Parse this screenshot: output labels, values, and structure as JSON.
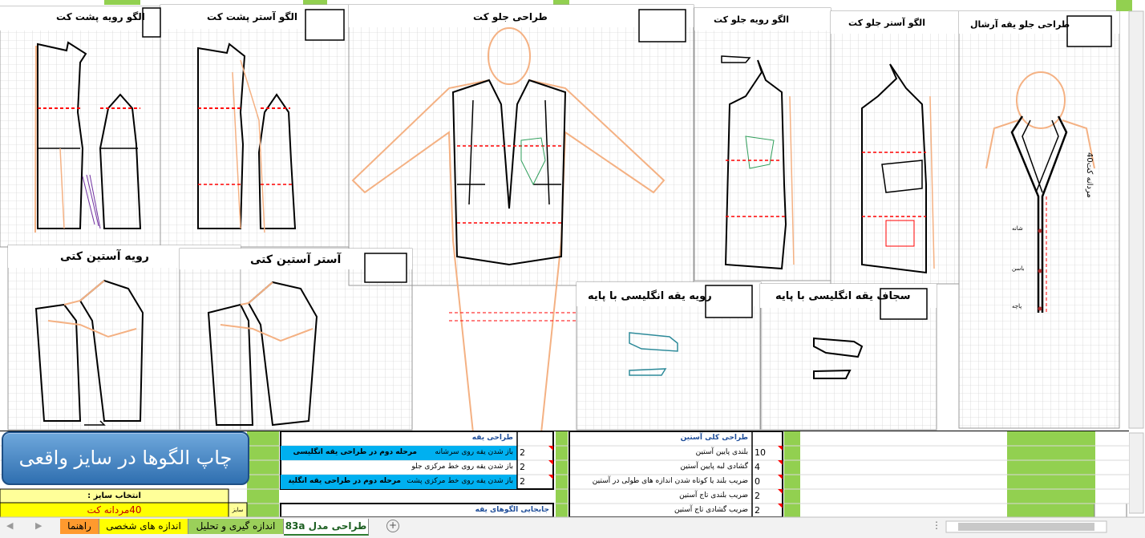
{
  "panels": {
    "back_outer_title": "الگو رویه پشت کت",
    "back_lining_title": "الگو آستر پشت کت",
    "front_design_title": "طراحی جلو کت",
    "front_outer_title": "الگو رویه جلو کت",
    "front_lining_title": "الگو آستر جلو کت",
    "shawl_collar_title": "طراحی جلو یقه آرشال",
    "sleeve_outer_title": "رویه آستین کتی",
    "sleeve_lining_title": "آستر آستین کتی",
    "collar_outer_title": "رویه یقه انگلیسی با پایه",
    "collar_interfacing_title": "سجاف یقه انگلیسی با پایه",
    "shawl_size_label": "40مردانه کت",
    "shawl_marks": [
      "شانه",
      "باسن",
      "پاچه"
    ]
  },
  "print_button": {
    "label": "چاپ الگوها در سایز واقعی"
  },
  "size_selector": {
    "heading": "انتخاب سایز :",
    "value": "40مردانه کت",
    "side_label": "سایز من"
  },
  "collar_table": {
    "header": "طراحی یقه",
    "rows": [
      {
        "value": "2",
        "label": "باز شدن یقه روی سرشانه",
        "note": "مرحله دوم در طراحی یقه انگلیسی"
      },
      {
        "value": "2",
        "label": "باز شدن یقه روی خط مرکزی جلو",
        "note": ""
      },
      {
        "value": "2",
        "label": "باز شدن یقه روی خط مرکزی پشت",
        "note": "مرحله دوم در طراحی یقه انگلیسی"
      }
    ],
    "footer": "جابجایی الگوهای یقه"
  },
  "sleeve_table": {
    "header": "طراحی کلی آستین",
    "rows": [
      {
        "value": "10",
        "label": "بلندی پایین آستین"
      },
      {
        "value": "4",
        "label": "گشادی لبه پایین آستین"
      },
      {
        "value": "0",
        "label": "ضریب بلند یا کوتاه شدن اندازه های طولی در آستین"
      },
      {
        "value": "2",
        "label": "ضریب بلندی تاج آستین"
      },
      {
        "value": "2",
        "label": "ضریب گشادی تاج آستین"
      }
    ]
  },
  "sheet_tabs": [
    {
      "label": "طراحی مدل 83a",
      "active": true,
      "color": "#ffffff"
    },
    {
      "label": "اندازه گیری و تحلیل",
      "active": false,
      "color": "#9bd05a"
    },
    {
      "label": "اندازه های شخصی",
      "active": false,
      "color": "#ffff00"
    },
    {
      "label": "راهنما",
      "active": false,
      "color": "#ff9a2e"
    }
  ],
  "colors": {
    "accent_green": "#92d050",
    "pattern_orange": "#f4b183",
    "pattern_black": "#000000",
    "dart_red": "#ff0000",
    "cyan_cell": "#00b0f0",
    "yellow_cell": "#ffff00"
  }
}
